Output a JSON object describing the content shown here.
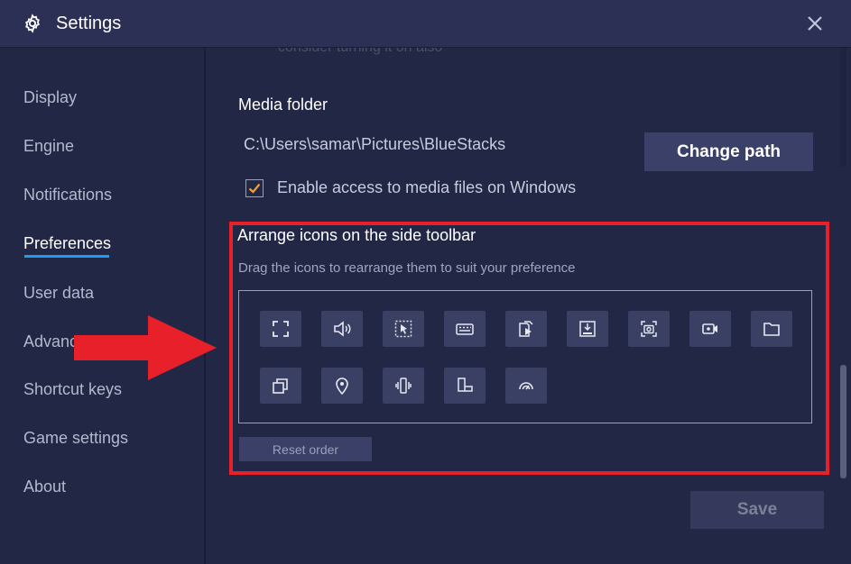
{
  "window": {
    "title": "Settings"
  },
  "sidebar": {
    "items": [
      {
        "label": "Display"
      },
      {
        "label": "Engine"
      },
      {
        "label": "Notifications"
      },
      {
        "label": "Preferences",
        "active": true
      },
      {
        "label": "User data"
      },
      {
        "label": "Advanc"
      },
      {
        "label": "Shortcut keys"
      },
      {
        "label": "Game settings"
      },
      {
        "label": "About"
      }
    ]
  },
  "content": {
    "faded_text": "consider turning it on also",
    "media_folder": {
      "title": "Media folder",
      "path": "C:\\Users\\samar\\Pictures\\BlueStacks",
      "change_button": "Change path",
      "checkbox_label": "Enable access to media files on Windows",
      "checkbox_checked": true
    },
    "toolbar_section": {
      "title": "Arrange icons on the side toolbar",
      "hint": "Drag the icons to rearrange them to suit your preference",
      "icons": [
        "fullscreen-icon",
        "volume-icon",
        "pointer-select-icon",
        "keyboard-icon",
        "media-manager-icon",
        "install-apk-icon",
        "screenshot-icon",
        "screen-record-icon",
        "folder-icon",
        "multi-instance-icon",
        "location-icon",
        "shake-icon",
        "rotate-icon",
        "eco-mode-icon"
      ],
      "reset_button": "Reset order"
    },
    "save_button": "Save"
  },
  "colors": {
    "accent": "#1c9df4",
    "highlight": "#e8202a",
    "checkbox": "#f0a030",
    "background": "#232746"
  }
}
